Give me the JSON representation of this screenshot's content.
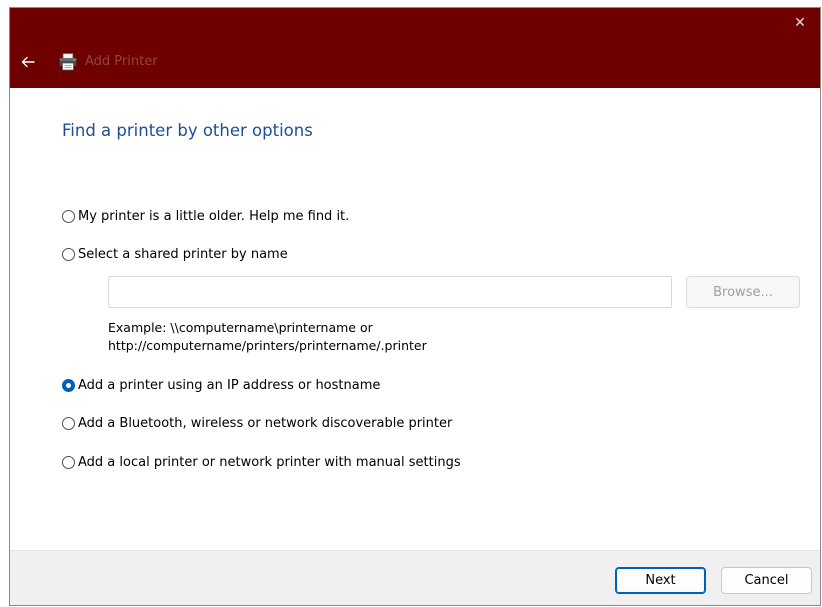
{
  "window": {
    "title": "Add Printer",
    "close_glyph": "✕",
    "back_glyph": "←",
    "title_icon": "printer-icon"
  },
  "page": {
    "heading": "Find a printer by other options"
  },
  "options": [
    {
      "label": "My printer is a little older. Help me find it.",
      "checked": false
    },
    {
      "label": "Select a shared printer by name",
      "checked": false
    },
    {
      "label": "Add a printer using an IP address or hostname",
      "checked": true
    },
    {
      "label": "Add a Bluetooth, wireless or network discoverable printer",
      "checked": false
    },
    {
      "label": "Add a local printer or network printer with manual settings",
      "checked": false
    }
  ],
  "shared_printer": {
    "value": "",
    "browse_label": "Browse...",
    "example_line1": "Example: \\\\computername\\printername or",
    "example_line2": "http://computername/printers/printername/.printer"
  },
  "footer": {
    "next_label": "Next",
    "cancel_label": "Cancel"
  },
  "colors": {
    "titlebar": "#6f0000",
    "heading": "#1e4e99",
    "accent": "#005fb8"
  }
}
